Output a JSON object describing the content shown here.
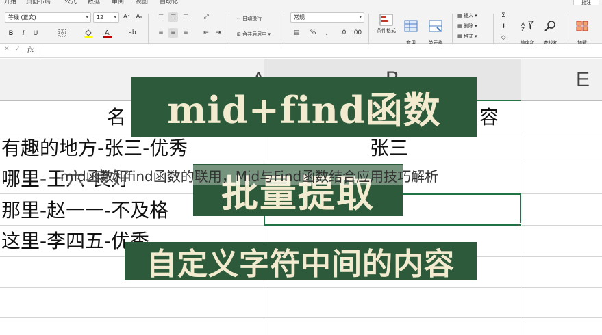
{
  "menubar": {
    "tabs": [
      "开始",
      "页面布局",
      "公式",
      "数据",
      "审阅",
      "视图",
      "自动化"
    ],
    "comments_button": "批注"
  },
  "ribbon": {
    "font_name": "等线 (正文)",
    "font_size": "12",
    "bold": "B",
    "italic": "I",
    "underline": "U",
    "wrap_text": "自动换行",
    "merge_center": "合并后居中",
    "number_format": "常规",
    "conditional_format": "条件格式",
    "format_as_table": "套用\n表格格式",
    "cell_styles": "单元格\n样式",
    "insert": "插入",
    "delete": "删除",
    "format": "格式",
    "sort_filter": "排序和\n筛选",
    "find_select": "查找和\n选择",
    "addins": "加载\n项",
    "accent_color": "#217346",
    "font_color_swatch": "#c00000",
    "fill_color_swatch": "#ffff00"
  },
  "formula_bar": {
    "fx_label": "fx",
    "cancel": "✕",
    "confirm": "✓"
  },
  "sheet": {
    "columns": [
      "A",
      "B",
      "E"
    ],
    "selected_column": "B",
    "header_row": {
      "a": "名",
      "b": "容"
    },
    "rows": [
      {
        "a": "有趣的地方-张三-优秀",
        "b": "张三"
      },
      {
        "a": "哪里-王六-良好",
        "b": ""
      },
      {
        "a": "那里-赵一一-不及格",
        "b": ""
      },
      {
        "a": "这里-李四五-优秀",
        "b": ""
      }
    ]
  },
  "overlay": {
    "title_banner": "mid+find函数",
    "subtitle_banner": "批量提取",
    "bottom_banner": "自定义字符中间的内容",
    "caption": "mid函数和find函数的联用，Mid与Find函数结合应用技巧解析",
    "banner_color": "#2d5a3a",
    "banner_text_color": "#f3ebcf"
  }
}
